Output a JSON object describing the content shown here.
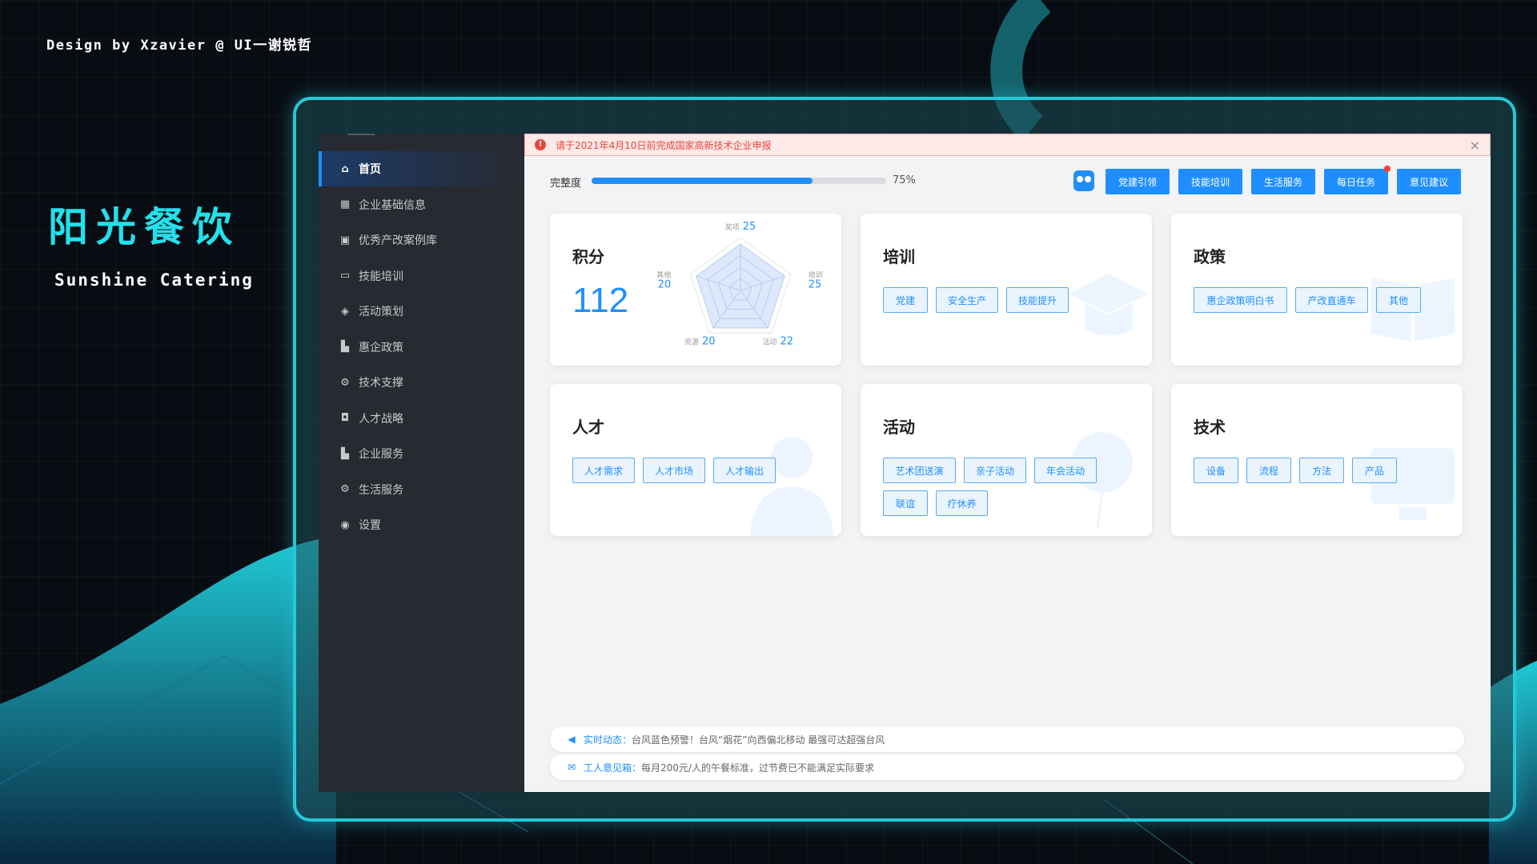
{
  "credit": "Design by Xzavier @ UI一谢锐哲",
  "brand": {
    "cn": "阳光餐饮",
    "en": "Sunshine Catering"
  },
  "alert": {
    "text": "请于2021年4月10日前完成国家高新技术企业申报",
    "close": "×"
  },
  "sidebar": {
    "items": [
      {
        "label": "首页",
        "icon": "home-icon",
        "glyph": "⌂",
        "active": true
      },
      {
        "label": "企业基础信息",
        "icon": "grid-icon",
        "glyph": "▦"
      },
      {
        "label": "优秀产改案例库",
        "icon": "image-icon",
        "glyph": "▣"
      },
      {
        "label": "技能培训",
        "icon": "monitor-icon",
        "glyph": "▭"
      },
      {
        "label": "活动策划",
        "icon": "layers-icon",
        "glyph": "◈"
      },
      {
        "label": "惠企政策",
        "icon": "building-icon",
        "glyph": "▙"
      },
      {
        "label": "技术支撑",
        "icon": "gear-icon",
        "glyph": "⚙"
      },
      {
        "label": "人才战略",
        "icon": "shield-icon",
        "glyph": "◘"
      },
      {
        "label": "企业服务",
        "icon": "building-icon",
        "glyph": "▙"
      },
      {
        "label": "生活服务",
        "icon": "gear-icon",
        "glyph": "⚙"
      },
      {
        "label": "设置",
        "icon": "settings-icon",
        "glyph": "◉"
      }
    ]
  },
  "progress": {
    "label": "完整度",
    "value": 0.75,
    "value_text": "75%"
  },
  "toolbar": {
    "buttons": [
      "党建引领",
      "技能培训",
      "生活服务",
      "每日任务",
      "意见建议"
    ],
    "notification_on": "每日任务"
  },
  "cards": {
    "points": {
      "title": "积分",
      "score": "112",
      "radar": [
        {
          "label": "奖项",
          "value": "25"
        },
        {
          "label": "培训",
          "value": "25"
        },
        {
          "label": "活动",
          "value": "22"
        },
        {
          "label": "资源",
          "value": "20"
        },
        {
          "label": "其他",
          "value": "20"
        }
      ]
    },
    "training": {
      "title": "培训",
      "tags": [
        "党建",
        "安全生产",
        "技能提升"
      ]
    },
    "policy": {
      "title": "政策",
      "tags": [
        "惠企政策明白书",
        "产改直通车",
        "其他"
      ]
    },
    "talent": {
      "title": "人才",
      "tags": [
        "人才需求",
        "人才市场",
        "人才输出"
      ]
    },
    "activity": {
      "title": "活动",
      "tags": [
        "艺术团送演",
        "亲子活动",
        "年会活动",
        "联谊",
        "疗休养"
      ]
    },
    "tech": {
      "title": "技术",
      "tags": [
        "设备",
        "流程",
        "方法",
        "产品"
      ]
    }
  },
  "news": {
    "label": "实时动态：",
    "text": "台风蓝色预警！台风“烟花”向西偏北移动 最强可达超强台风"
  },
  "feedback": {
    "label": "工人意见箱：",
    "text": "每月200元/人的午餐标准，过节费已不能满足实际要求"
  },
  "colors": {
    "accent": "#1f8fff",
    "brand": "#24e0ea",
    "alert": "#e8453c"
  }
}
